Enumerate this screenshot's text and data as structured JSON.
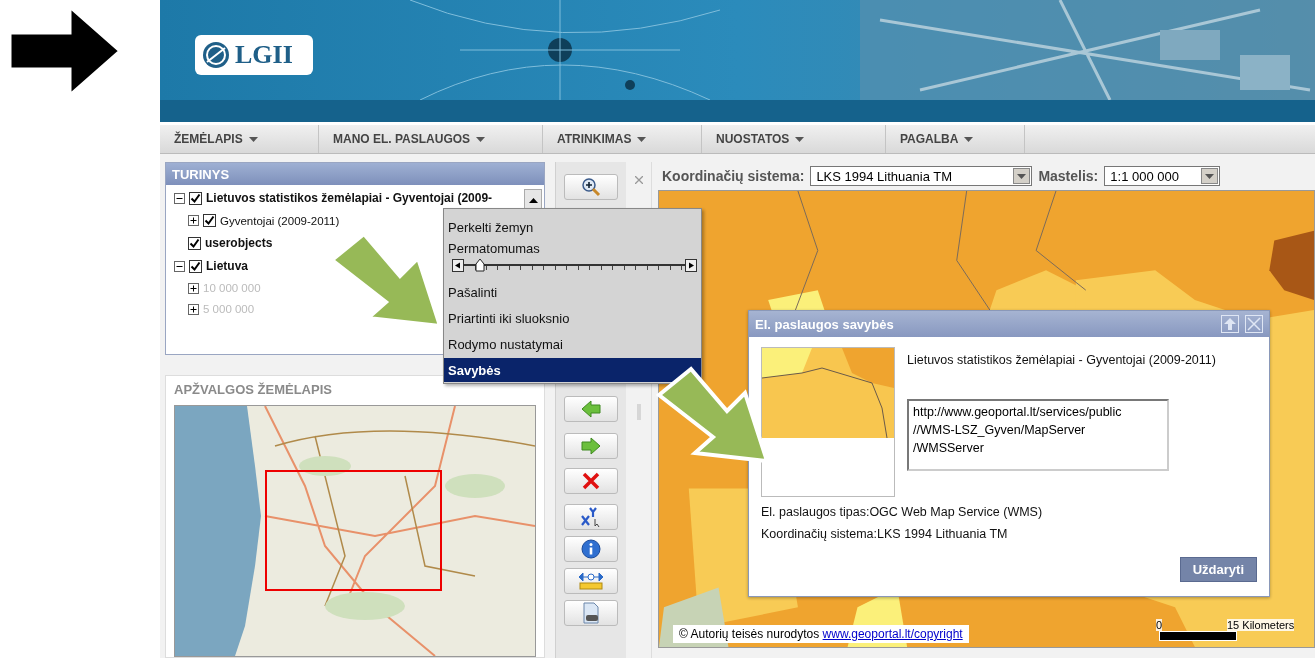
{
  "header": {
    "logo": "LGII"
  },
  "menu_bar": [
    {
      "label": "ŽEMĖLAPIS"
    },
    {
      "label": "MANO EL. PASLAUGOS"
    },
    {
      "label": "ATRINKIMAS"
    },
    {
      "label": "NUOSTATOS"
    },
    {
      "label": "PAGALBA"
    }
  ],
  "contents_panel": {
    "title": "TURINYS",
    "tree": [
      {
        "label": "Lietuvos statistikos žemėlapiai - Gyventojai (2009-",
        "checked": true,
        "expanded": true,
        "disabled": false,
        "children": [
          {
            "label": "Gyventojai (2009-2011)",
            "checked": true,
            "expanded": false,
            "disabled": false
          }
        ]
      },
      {
        "label": "userobjects",
        "checked": true,
        "disabled": false
      },
      {
        "label": "Lietuva",
        "checked": true,
        "expanded": true,
        "disabled": false,
        "children": [
          {
            "label": "10 000 000",
            "expanded": false,
            "disabled": true
          },
          {
            "label": "5 000 000",
            "expanded": false,
            "disabled": true
          }
        ]
      }
    ]
  },
  "overview_panel": {
    "title": "APŽVALGOS ŽEMĖLAPIS"
  },
  "map_toolbar": {
    "crs_label": "Koordinačių sistema:",
    "crs_value": "LKS 1994 Lithuania TM",
    "scale_label": "Mastelis:",
    "scale_value": "1:1 000 000"
  },
  "map": {
    "copyright_text": "© Autorių teisės nurodytos",
    "copyright_link": "www.geoportal.lt/copyright",
    "scale_start": "0",
    "scale_end": "15 Kilometers"
  },
  "context_menu": {
    "items": [
      {
        "kind": "action",
        "label": "Perkelti žemyn",
        "selected": false
      },
      {
        "kind": "slider",
        "label": "Permatomumas",
        "level": 0.05
      },
      {
        "kind": "action",
        "label": "Pašalinti",
        "selected": false
      },
      {
        "kind": "action",
        "label": "Priartinti iki sluoksnio",
        "selected": false
      },
      {
        "kind": "action",
        "label": "Rodymo nustatymai",
        "selected": false
      },
      {
        "kind": "action",
        "label": "Savybės",
        "selected": true
      }
    ]
  },
  "dialog": {
    "title": "El. paslaugos savybės",
    "layer_name": "Lietuvos statistikos žemėlapiai - Gyventojai (2009-2011)",
    "url_lines": [
      "http://www.geoportal.lt/services/public",
      "//WMS-LSZ_Gyven/MapServer",
      "/WMSServer"
    ],
    "type_line": "El. paslaugos tipas:OGC Web Map Service (WMS)",
    "crs_line": "Koordinačių sistema:LKS 1994 Lithuania TM",
    "close_button": "Uždaryti"
  }
}
